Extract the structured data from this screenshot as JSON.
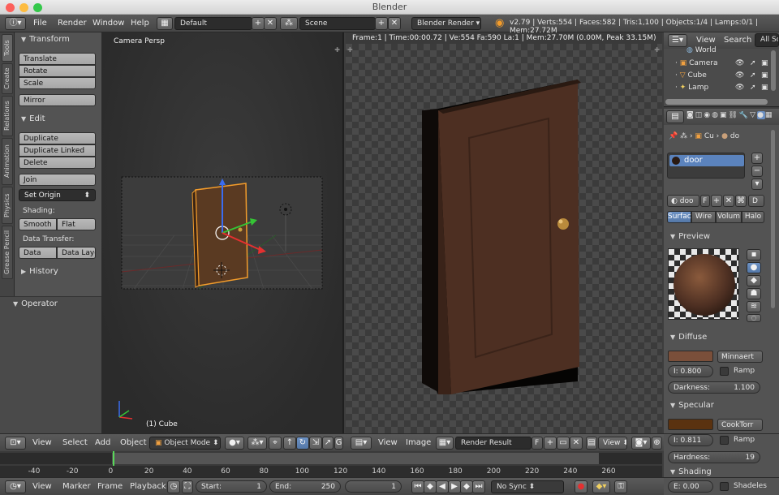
{
  "window": {
    "title": "Blender"
  },
  "menubar": {
    "items": [
      "File",
      "Render",
      "Window",
      "Help"
    ],
    "layout": "Default",
    "scene": "Scene",
    "engine": "Blender Render",
    "stats": "v2.79 | Verts:554 | Faces:582 | Tris:1,100 | Objects:1/4 | Lamps:0/1 | Mem:27.72M"
  },
  "tabs": [
    "Tools",
    "Create",
    "Relations",
    "Animation",
    "Physics",
    "Grease Pencil"
  ],
  "toolshelf": {
    "transform_header": "Transform",
    "translate": "Translate",
    "rotate": "Rotate",
    "scale": "Scale",
    "mirror": "Mirror",
    "edit_header": "Edit",
    "duplicate": "Duplicate",
    "duplicate_linked": "Duplicate Linked",
    "delete": "Delete",
    "join": "Join",
    "set_origin": "Set Origin",
    "shading_label": "Shading:",
    "smooth": "Smooth",
    "flat": "Flat",
    "data_transfer_label": "Data Transfer:",
    "data": "Data",
    "data_layo": "Data Layo",
    "history_header": "History",
    "operator_header": "Operator"
  },
  "viewport3d": {
    "label": "Camera Persp",
    "object_label": "(1) Cube"
  },
  "render_view": {
    "info": "Frame:1 | Time:00:00.72 | Ve:554 Fa:590 La:1 | Mem:27.70M (0.00M, Peak 33.15M)"
  },
  "outliner": {
    "view": "View",
    "search": "Search",
    "all_scenes": "All Sc",
    "rows": [
      "World",
      "Camera",
      "Cube",
      "Lamp"
    ]
  },
  "properties": {
    "breadcrumb_obj": "Cu",
    "breadcrumb_mat": "do",
    "material_slot": "door",
    "material_name": "doo",
    "f_label": "F",
    "d_label": "D",
    "surface_tabs": [
      "Surfac",
      "Wire",
      "Volum",
      "Halo"
    ],
    "preview_header": "Preview",
    "diffuse_header": "Diffuse",
    "diffuse_color": "#7a4f3a",
    "diffuse_shader": "Minnaert",
    "diffuse_intensity": "I: 0.800",
    "ramp": "Ramp",
    "darkness": "Darkness:",
    "darkness_value": "1.100",
    "specular_header": "Specular",
    "specular_color": "#5a3210",
    "specular_shader": "CookTorr",
    "specular_intensity": "I: 0.811",
    "hardness": "Hardness:",
    "hardness_value": "19",
    "shading_header": "Shading",
    "shading_e": "E: 0.00",
    "shadeless": "Shadeles"
  },
  "viewport_header": {
    "view": "View",
    "select": "Select",
    "add": "Add",
    "object": "Object",
    "mode": "Object Mode"
  },
  "image_header": {
    "view": "View",
    "image": "Image",
    "render_result": "Render Result",
    "f": "F",
    "view2": "View"
  },
  "timeline": {
    "ticks": [
      "-40",
      "-20",
      "0",
      "20",
      "40",
      "60",
      "80",
      "100",
      "120",
      "140",
      "160",
      "180",
      "200",
      "220",
      "240",
      "260"
    ]
  },
  "timeline_header": {
    "view": "View",
    "marker": "Marker",
    "frame": "Frame",
    "playback": "Playback",
    "start": "Start:",
    "start_value": "1",
    "end": "End:",
    "end_value": "250",
    "current": "1",
    "sync": "No Sync"
  }
}
